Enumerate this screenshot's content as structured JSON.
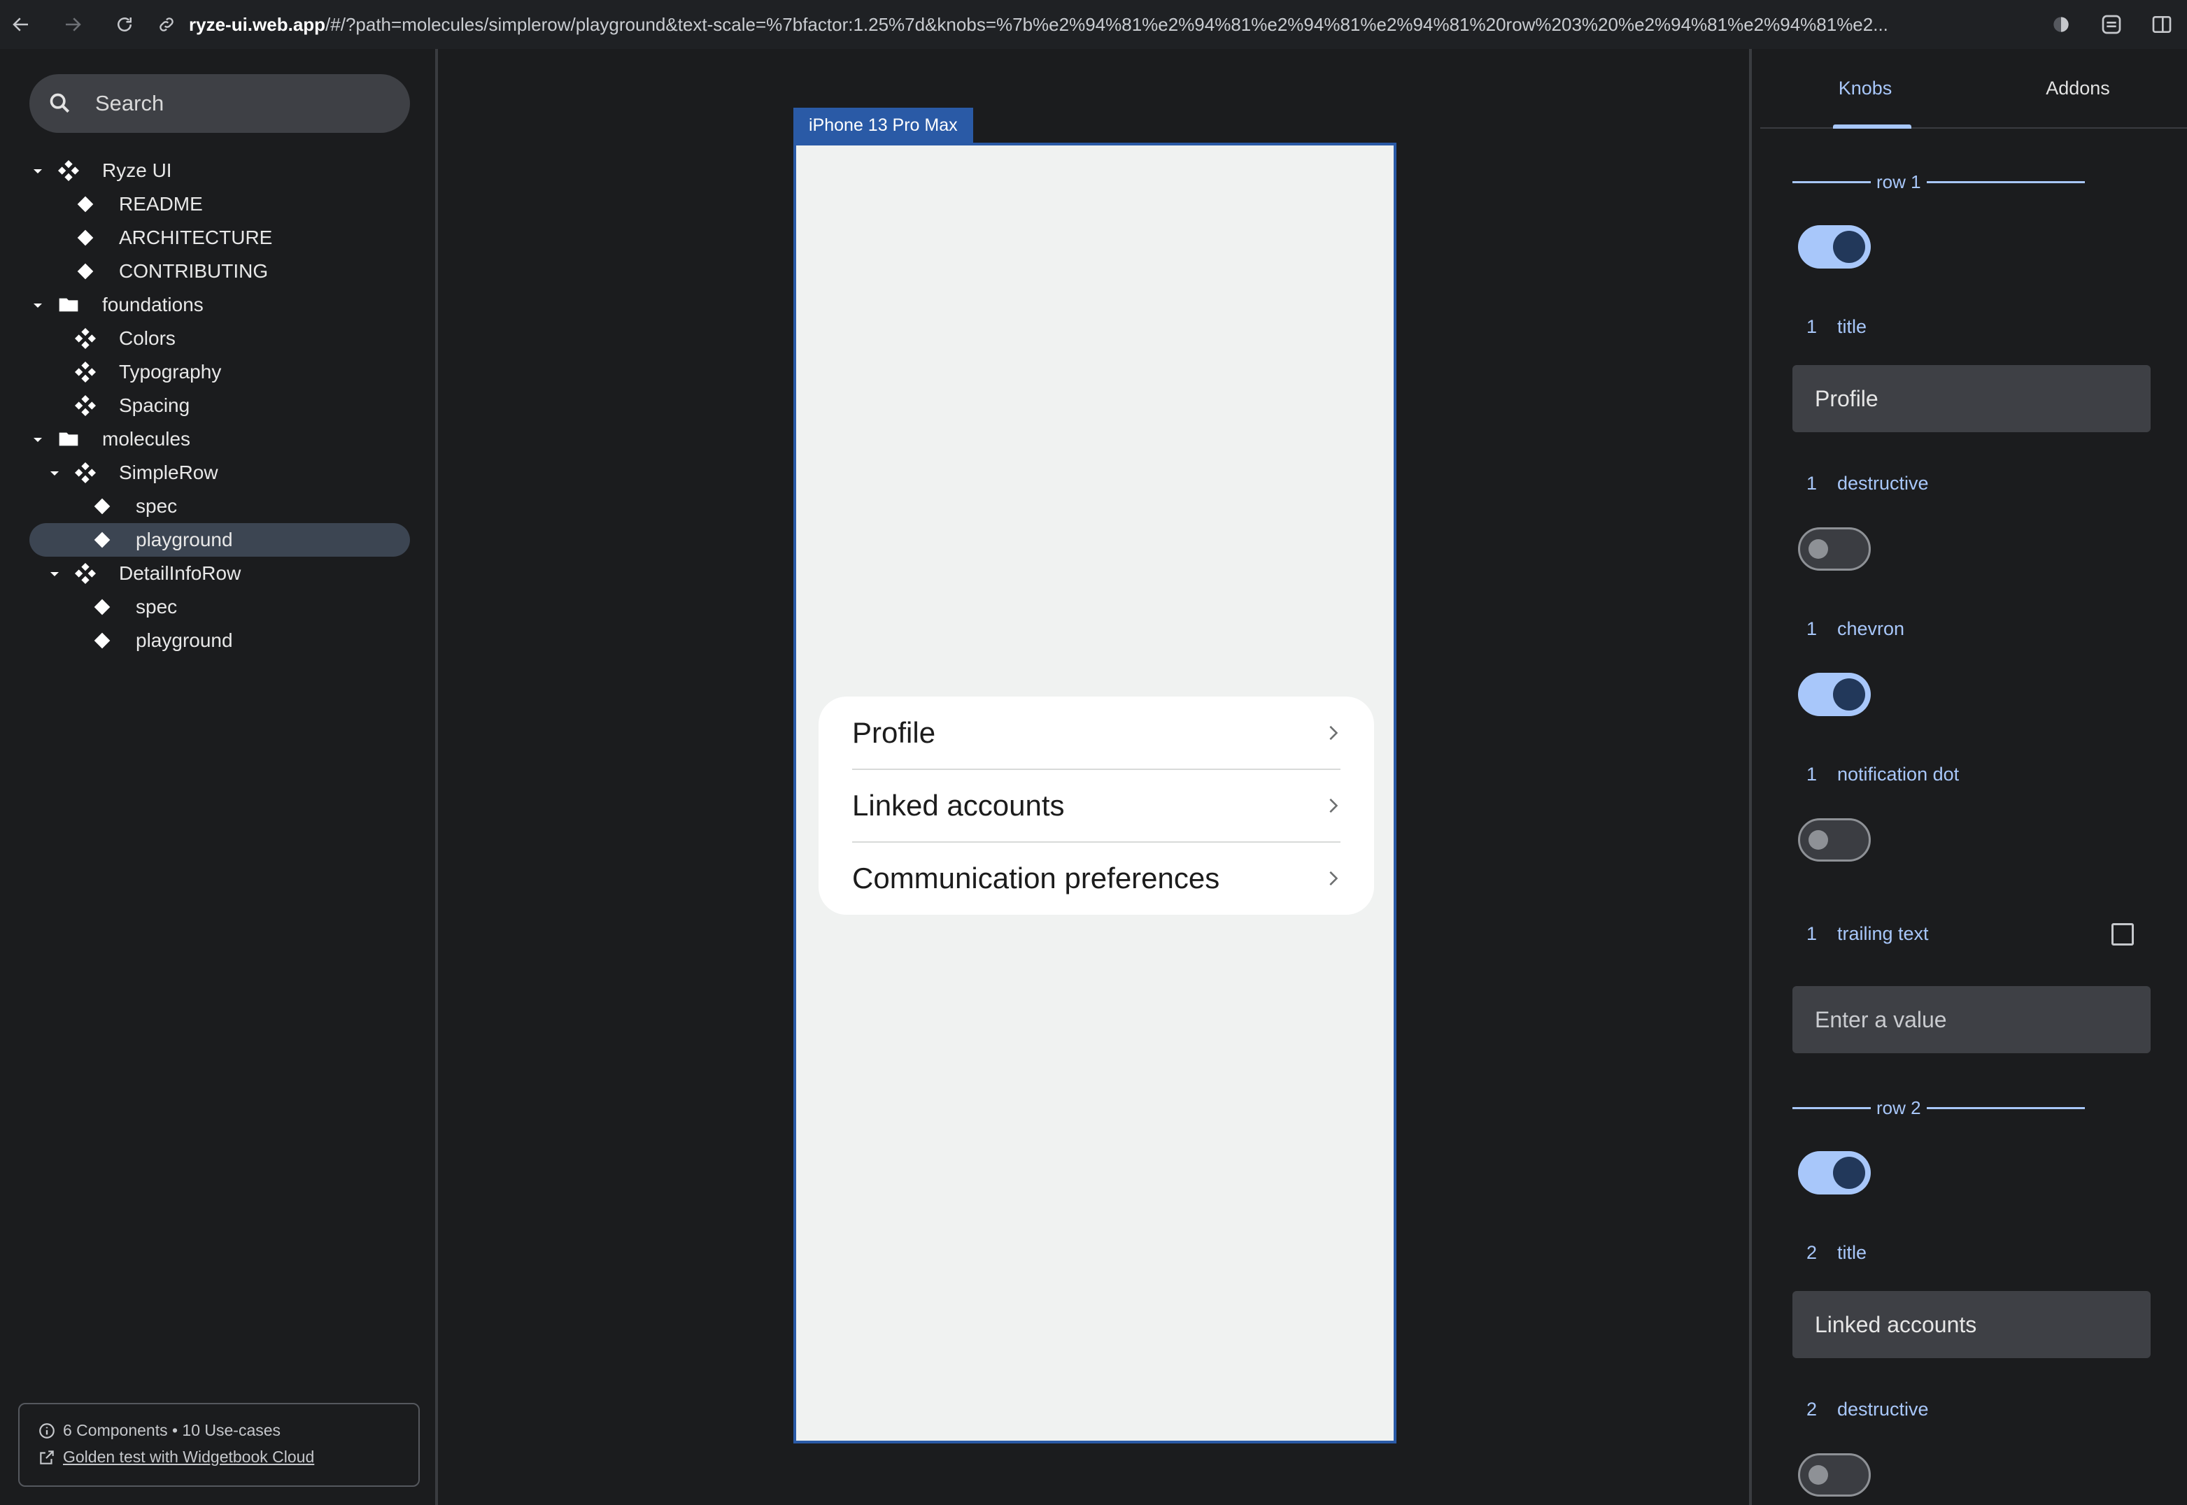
{
  "browser": {
    "url_host": "ryze-ui.web.app",
    "url_rest": "/#/?path=molecules/simplerow/playground&text-scale=%7bfactor:1.25%7d&knobs=%7b%e2%94%81%e2%94%81%e2%94%81%e2%94%81%20row%203%20%e2%94%81%e2%94%81%e2..."
  },
  "sidebar": {
    "search_placeholder": "Search",
    "tree": [
      {
        "label": "Ryze UI",
        "icon": "component-icon",
        "level": 0,
        "expanded": true
      },
      {
        "label": "README",
        "icon": "diamond-icon",
        "level": 1
      },
      {
        "label": "ARCHITECTURE",
        "icon": "diamond-icon",
        "level": 1
      },
      {
        "label": "CONTRIBUTING",
        "icon": "diamond-icon",
        "level": 1
      },
      {
        "label": "foundations",
        "icon": "folder-icon",
        "level": 0,
        "expanded": true
      },
      {
        "label": "Colors",
        "icon": "component-icon",
        "level": 1
      },
      {
        "label": "Typography",
        "icon": "component-icon",
        "level": 1
      },
      {
        "label": "Spacing",
        "icon": "component-icon",
        "level": 1
      },
      {
        "label": "molecules",
        "icon": "folder-icon",
        "level": 0,
        "expanded": true
      },
      {
        "label": "SimpleRow",
        "icon": "component-icon",
        "level": 1,
        "expanded": true
      },
      {
        "label": "spec",
        "icon": "diamond-icon",
        "level": 2
      },
      {
        "label": "playground",
        "icon": "diamond-icon",
        "level": 2,
        "selected": true
      },
      {
        "label": "DetailInfoRow",
        "icon": "component-icon",
        "level": 1,
        "expanded": true
      },
      {
        "label": "spec",
        "icon": "diamond-icon",
        "level": 2
      },
      {
        "label": "playground",
        "icon": "diamond-icon",
        "level": 2
      }
    ],
    "footer": {
      "stats": "6 Components • 10 Use-cases",
      "link": "Golden test with Widgetbook Cloud"
    }
  },
  "preview": {
    "device_name": "iPhone 13 Pro Max",
    "rows": [
      {
        "title": "Profile"
      },
      {
        "title": "Linked accounts"
      },
      {
        "title": "Communication preferences"
      }
    ]
  },
  "knobs_panel": {
    "tabs": [
      {
        "label": "Knobs",
        "active": true
      },
      {
        "label": "Addons",
        "active": false
      }
    ],
    "row1": {
      "header": "row 1",
      "enabled": true,
      "title_label": "title",
      "title_value": "Profile",
      "destructive_label": "destructive",
      "destructive": false,
      "chevron_label": "chevron",
      "chevron": true,
      "notification_dot_label": "notification dot",
      "notification_dot": false,
      "trailing_text_label": "trailing text",
      "trailing_text_enabled": false,
      "trailing_text_placeholder": "Enter a value",
      "index": "1"
    },
    "row2": {
      "header": "row 2",
      "enabled": true,
      "title_label": "title",
      "title_value": "Linked accounts",
      "destructive_label": "destructive",
      "destructive": false,
      "index": "2"
    }
  },
  "colors": {
    "accent": "#a8c7fa",
    "device_frame": "#2a5aa6",
    "background": "#1b1c1e"
  }
}
